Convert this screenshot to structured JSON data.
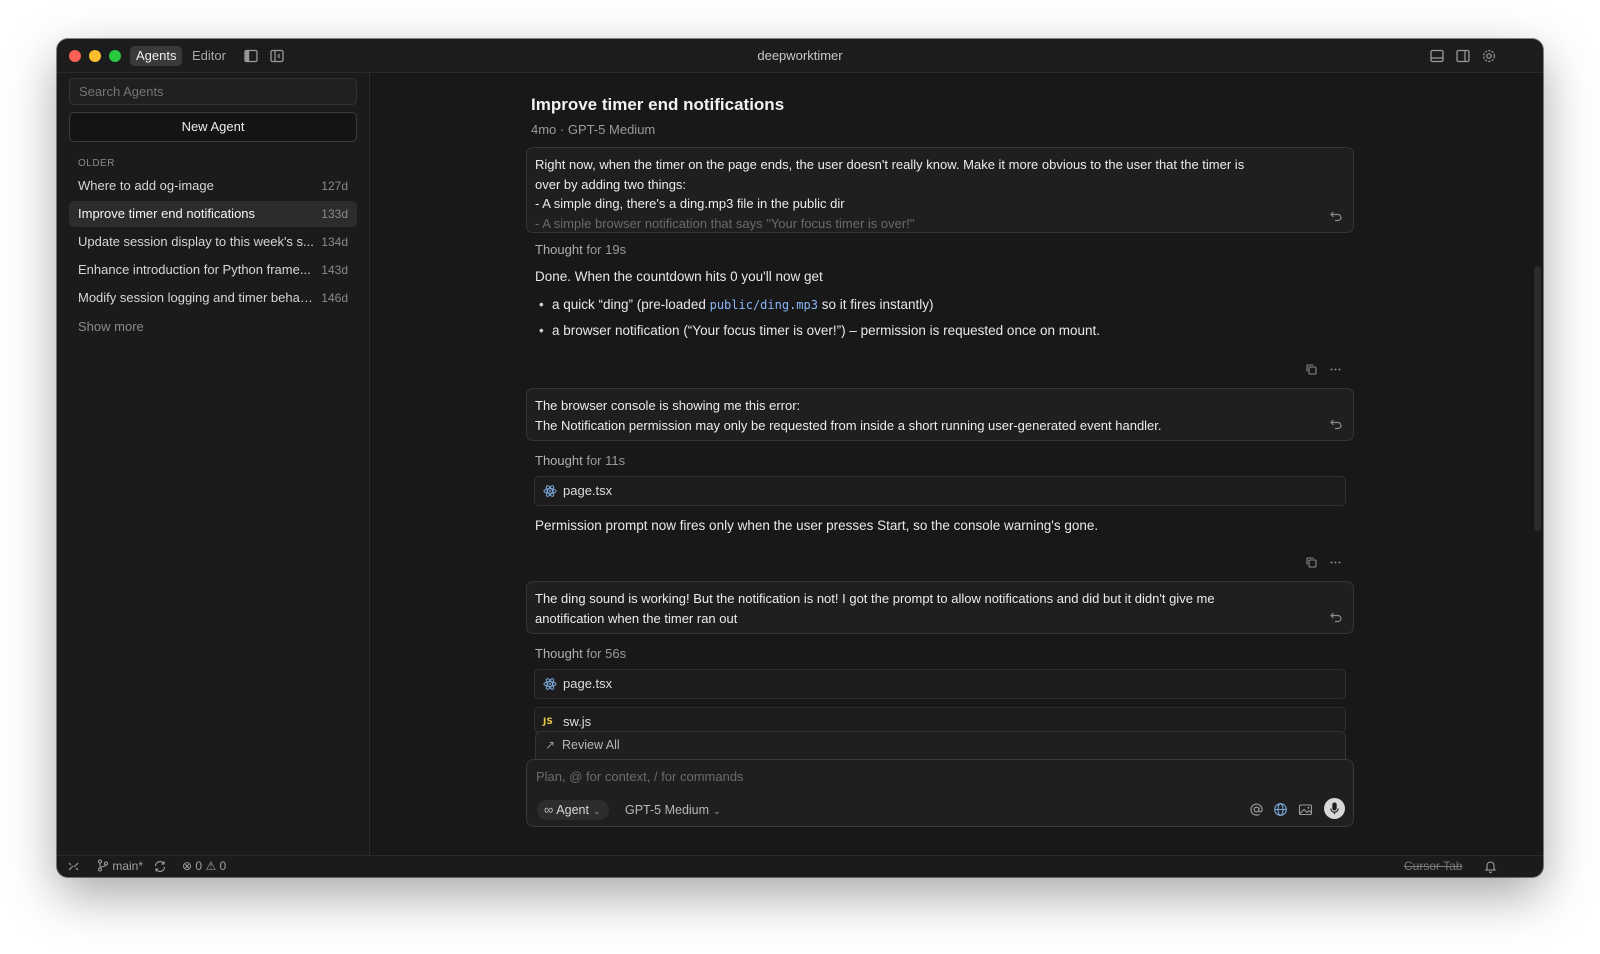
{
  "window": {
    "title": "deepworktimer"
  },
  "titlebar": {
    "tabs": [
      {
        "label": "Agents",
        "active": true
      },
      {
        "label": "Editor",
        "active": false
      }
    ]
  },
  "sidebar": {
    "search_placeholder": "Search Agents",
    "new_agent_label": "New Agent",
    "section_label": "OLDER",
    "agents": [
      {
        "title": "Where to add og-image",
        "age": "127d",
        "active": false
      },
      {
        "title": "Improve timer end notifications",
        "age": "133d",
        "active": true
      },
      {
        "title": "Update session display to this week's s...",
        "age": "134d",
        "active": false
      },
      {
        "title": "Enhance introduction for Python frame...",
        "age": "143d",
        "active": false
      },
      {
        "title": "Modify session logging and timer behav...",
        "age": "146d",
        "active": false
      }
    ],
    "show_more_label": "Show more"
  },
  "conversation": {
    "title": "Improve timer end notifications",
    "meta": "4mo · GPT-5 Medium",
    "messages": {
      "user1": {
        "line1": "Right now, when the timer on the page ends, the user doesn't really know. Make it more obvious to the user that the timer is",
        "line2": "over by adding two things:",
        "line3": "- A simple ding, there's a ding.mp3 file in the public dir",
        "line4": "- A simple browser notification that says \"Your focus timer is over!\""
      },
      "thought1": {
        "label": "Thought",
        "duration": "for 19s"
      },
      "reply1": {
        "intro": "Done. When the countdown hits 0 you'll now get",
        "bullet1_pre": "a quick “ding” (pre-loaded ",
        "bullet1_code": "public/ding.mp3",
        "bullet1_post": " so it fires instantly)",
        "bullet2": "a browser notification (“Your focus timer is over!”) – permission is requested once on mount."
      },
      "user2": {
        "line1": "The browser console is showing me this error:",
        "line2": "The Notification permission may only be requested from inside a short running user-generated event handler."
      },
      "thought2": {
        "label": "Thought",
        "duration": "for 11s"
      },
      "file1": "page.tsx",
      "reply2": "Permission prompt now fires only when the user presses Start, so the console warning's gone.",
      "user3": {
        "line1": "The ding sound is working! But the notification is not! I got the prompt to allow notifications and did but it didn't give me",
        "line2": "anotification when the timer ran out"
      },
      "thought3": {
        "label": "Thought",
        "duration": "for 56s"
      },
      "file2": "page.tsx",
      "file3": "sw.js"
    }
  },
  "review": {
    "label": "Review All"
  },
  "composer": {
    "placeholder": "Plan, @ for context, / for commands",
    "mode_label": "Agent",
    "model_label": "GPT-5 Medium"
  },
  "statusbar": {
    "branch": "main*",
    "errors": "0",
    "warnings": "0",
    "cursor_tab": "Cursor Tab"
  },
  "colors": {
    "accent_code": "#8ab4f8",
    "traffic_red": "#fe5f57",
    "traffic_yellow": "#febc2e",
    "traffic_green": "#28c840"
  }
}
